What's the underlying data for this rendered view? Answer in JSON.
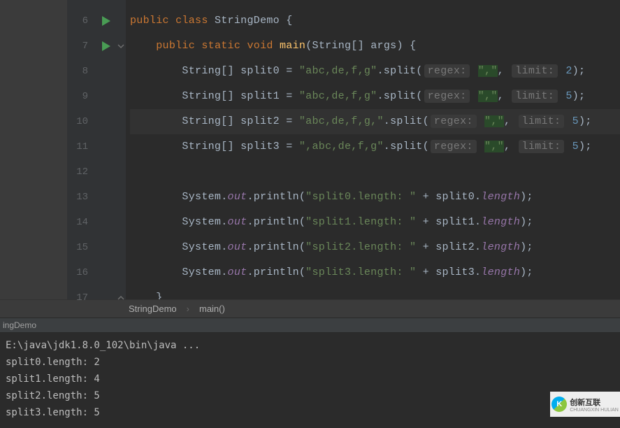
{
  "line_numbers": [
    "6",
    "7",
    "8",
    "9",
    "10",
    "11",
    "12",
    "13",
    "14",
    "15",
    "16",
    "17"
  ],
  "code": {
    "l6": {
      "public": "public",
      "class": "class",
      "name": "StringDemo",
      "brace": "{"
    },
    "l7": {
      "public": "public",
      "static": "static",
      "void": "void",
      "main": "main",
      "sig": "(String[] args)",
      "brace": "{"
    },
    "l8": {
      "decl": "String[] split0 = ",
      "str": "\"abc,de,f,g\"",
      "call": ".split(",
      "hint1": "regex:",
      "arg1": "\",\"",
      "hint2": "limit:",
      "arg2": "2",
      "close": ");"
    },
    "l9": {
      "decl": "String[] split1 = ",
      "str": "\"abc,de,f,g\"",
      "call": ".split(",
      "hint1": "regex:",
      "arg1": "\",\"",
      "hint2": "limit:",
      "arg2": "5",
      "close": ");"
    },
    "l10": {
      "decl": "String[] split2 = ",
      "str": "\"abc,de,f,g,\"",
      "call": ".split(",
      "hint1": "regex:",
      "arg1": "\",\"",
      "hint2": "limit:",
      "arg2": "5",
      "close": ");"
    },
    "l11": {
      "decl": "String[] split3 = ",
      "str": "\",abc,de,f,g\"",
      "call": ".split(",
      "hint1": "regex:",
      "arg1": "\",\"",
      "hint2": "limit:",
      "arg2": "5",
      "close": ");"
    },
    "l13": {
      "pre": "System.",
      "out": "out",
      "call": ".println(",
      "str": "\"split0.length: \"",
      "mid": " + split0.",
      "fld": "length",
      "close": ");"
    },
    "l14": {
      "pre": "System.",
      "out": "out",
      "call": ".println(",
      "str": "\"split1.length: \"",
      "mid": " + split1.",
      "fld": "length",
      "close": ");"
    },
    "l15": {
      "pre": "System.",
      "out": "out",
      "call": ".println(",
      "str": "\"split2.length: \"",
      "mid": " + split2.",
      "fld": "length",
      "close": ");"
    },
    "l16": {
      "pre": "System.",
      "out": "out",
      "call": ".println(",
      "str": "\"split3.length: \"",
      "mid": " + split3.",
      "fld": "length",
      "close": ");"
    },
    "l17": {
      "brace": "}"
    }
  },
  "breadcrumb": {
    "class": "StringDemo",
    "method": "main()"
  },
  "run_config": "ingDemo",
  "console": {
    "cmd": "E:\\java\\jdk1.8.0_102\\bin\\java ...",
    "out0": "split0.length: 2",
    "out1": "split1.length: 4",
    "out2": "split2.length: 5",
    "out3": "split3.length: 5"
  },
  "watermark": {
    "brand": "创新互联",
    "sub": "CHUANGXIN HULIAN"
  }
}
